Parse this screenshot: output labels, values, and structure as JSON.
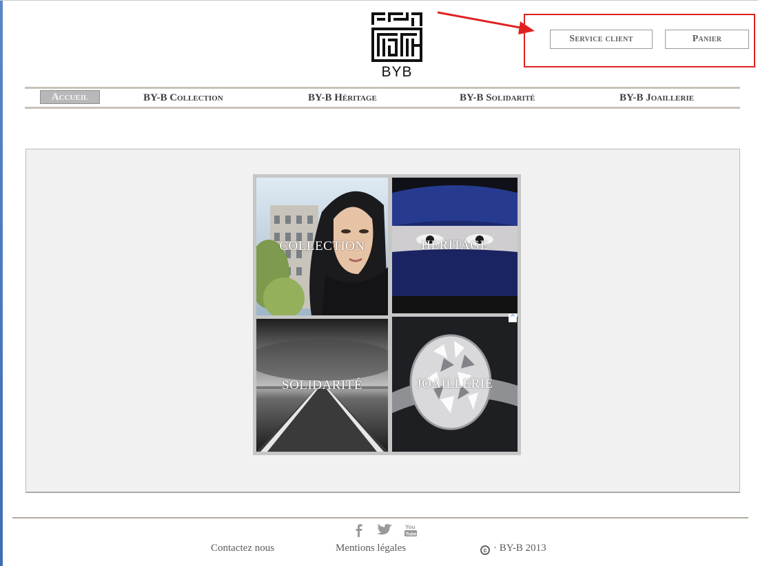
{
  "header": {
    "logo_text": "BYB",
    "service_client_label": "Service client",
    "panier_label": "Panier"
  },
  "nav": {
    "items": [
      {
        "label": "Accueil",
        "active": true
      },
      {
        "label": "BY-B Collection"
      },
      {
        "label": "BY-B  Héritage"
      },
      {
        "label": "BY-B Solidarité"
      },
      {
        "label": "BY-B Joaillerie"
      }
    ]
  },
  "tiles": [
    {
      "label": "COLLECTION"
    },
    {
      "label": "HERITAGE"
    },
    {
      "label": "SOLIDARITÉ"
    },
    {
      "label": "JOAILLERIE"
    }
  ],
  "footer": {
    "contact_label": "Contactez nous",
    "legal_label": "Mentions légales",
    "copyright_symbol": "c",
    "copyright_text": "· BY-B 2013",
    "social": [
      "facebook-icon",
      "twitter-icon",
      "youtube-icon"
    ]
  },
  "colors": {
    "annotation": "#e02020",
    "nav_text": "#3f3f3f",
    "panel_bg": "#f1f1f1"
  }
}
